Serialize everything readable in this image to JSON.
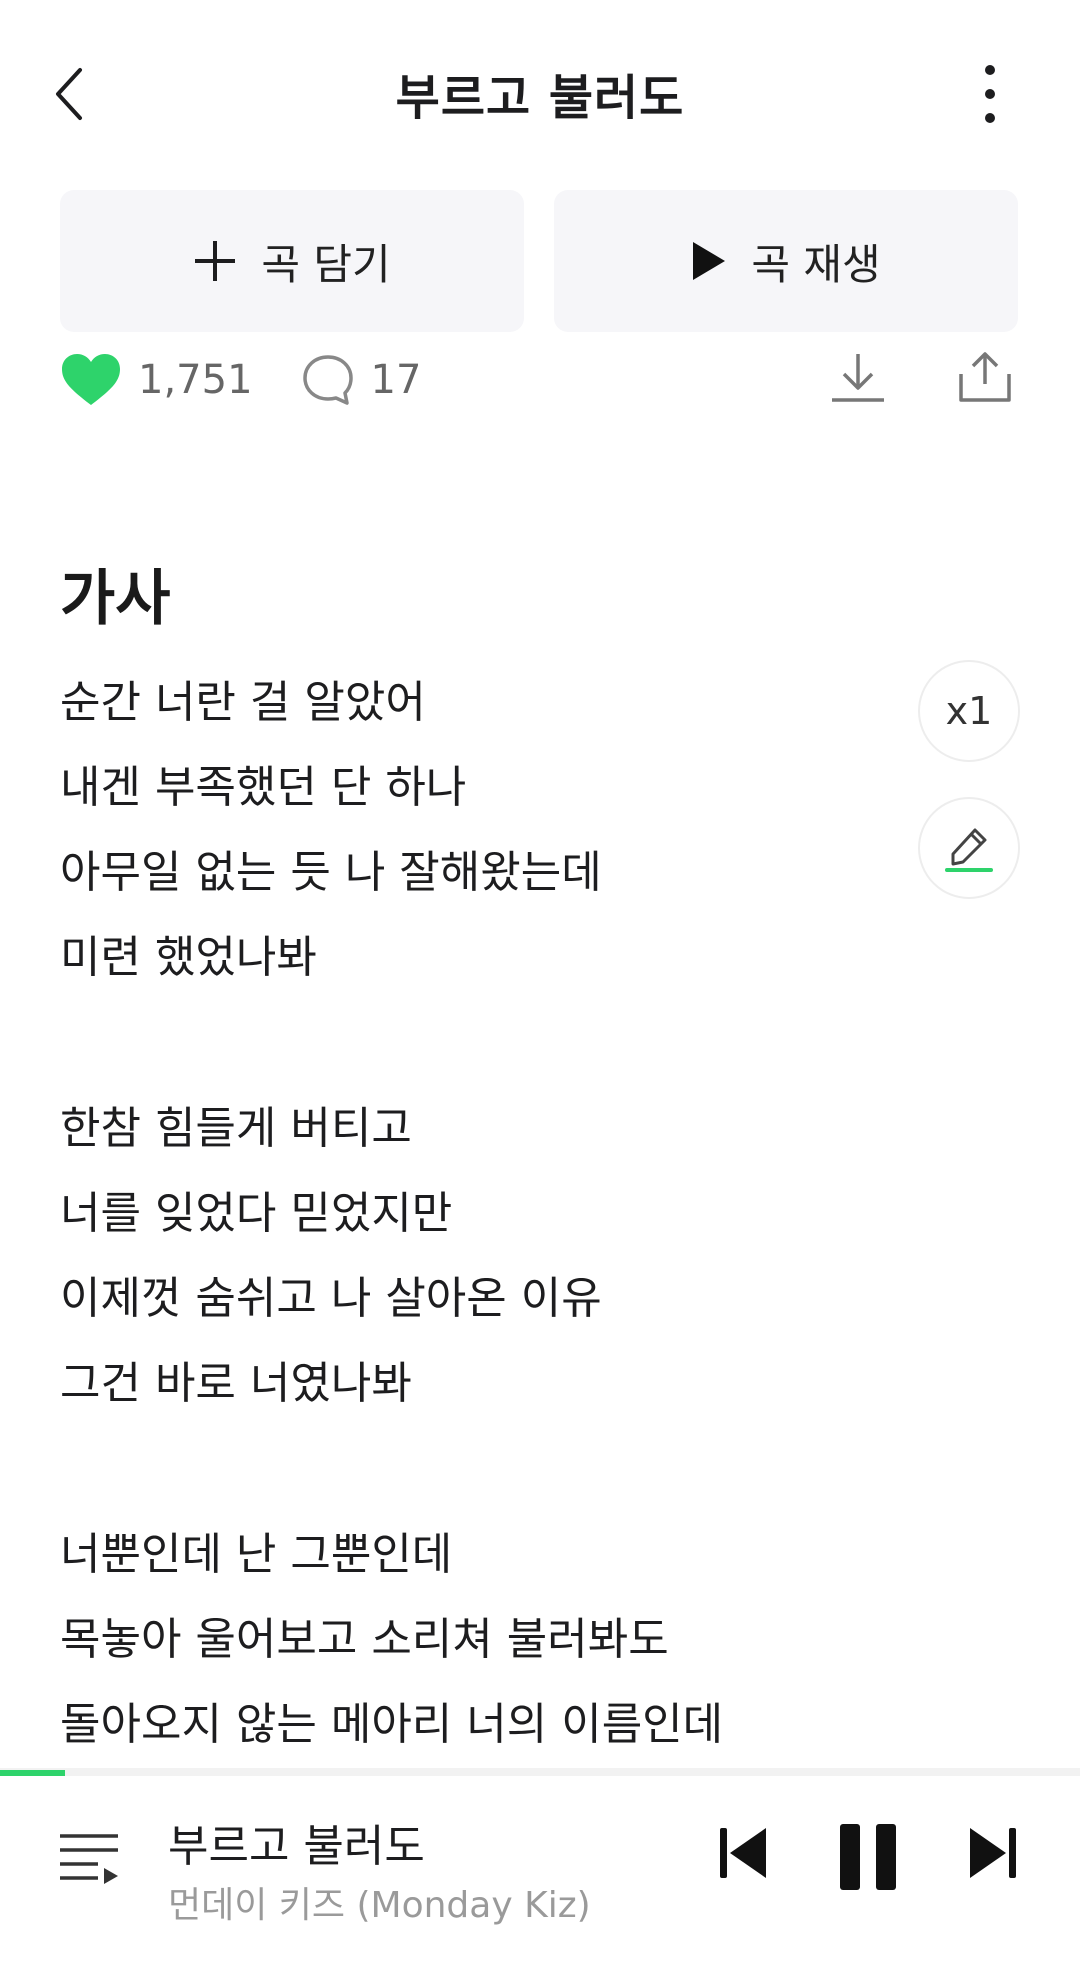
{
  "header": {
    "title": "부르고 불러도"
  },
  "actions": {
    "add_label": "곡 담기",
    "play_label": "곡 재생"
  },
  "stats": {
    "likes": "1,751",
    "comments": "17"
  },
  "lyrics": {
    "heading": "가사",
    "speed_label": "x1",
    "stanzas": [
      [
        "순간 너란 걸 알았어",
        "내겐 부족했던 단 하나",
        "아무일 없는 듯 나 잘해왔는데",
        "미련 했었나봐"
      ],
      [
        "한참 힘들게 버티고",
        "너를 잊었다 믿었지만",
        "이제껏 숨쉬고 나 살아온 이유",
        "그건 바로 너였나봐"
      ],
      [
        "너뿐인데 난 그뿐인데",
        "목놓아 울어보고 소리쳐 불러봐도",
        "돌아오지 않는 메아리 너의 이름인데"
      ]
    ]
  },
  "player": {
    "title": "부르고 불러도",
    "artist": "먼데이 키즈 (Monday Kiz)",
    "progress": 0.06
  },
  "colors": {
    "accent": "#2ed36b",
    "text": "#1d1d1f",
    "muted": "#9a9a9a"
  }
}
